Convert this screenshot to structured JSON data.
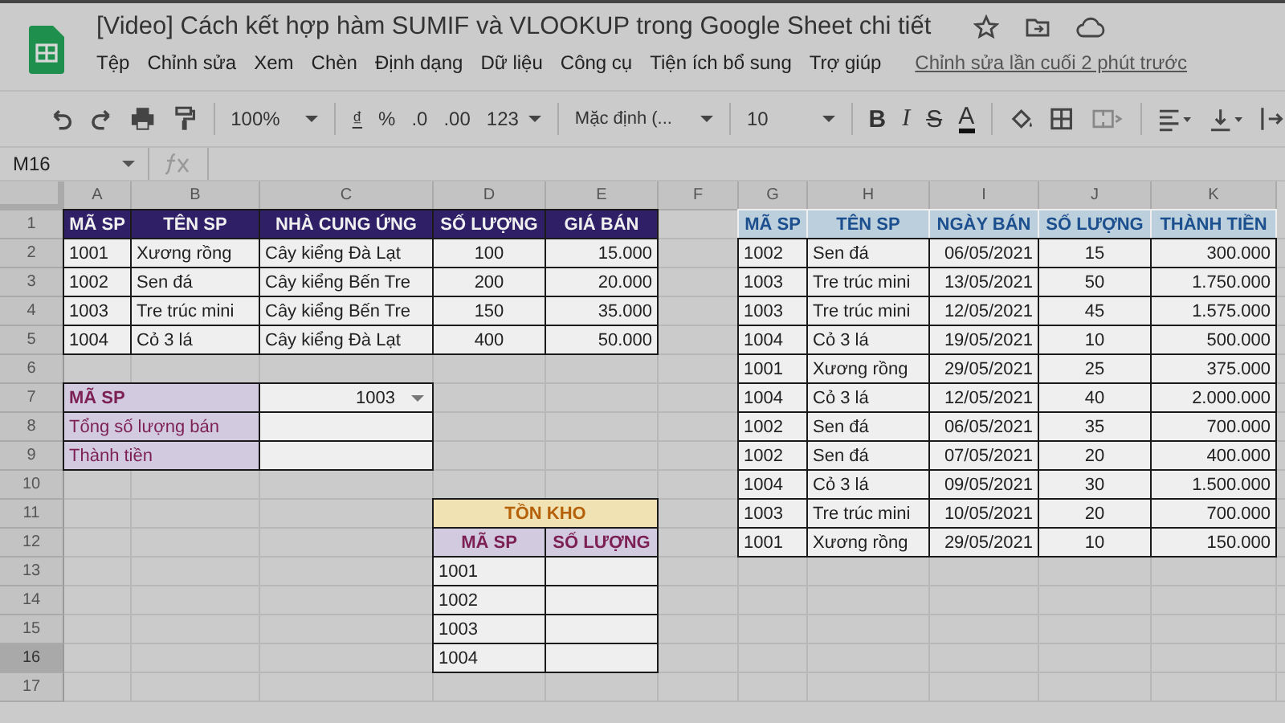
{
  "document": {
    "title": "[Video] Cách kết hợp hàm SUMIF và VLOOKUP trong Google Sheet chi tiết",
    "last_edit": "Chỉnh sửa lần cuối 2 phút trước"
  },
  "menu": [
    "Tệp",
    "Chỉnh sửa",
    "Xem",
    "Chèn",
    "Định dạng",
    "Dữ liệu",
    "Công cụ",
    "Tiện ích bổ sung",
    "Trợ giúp"
  ],
  "toolbar": {
    "zoom": "100%",
    "currency": "₫",
    "percent": "%",
    "decrease_decimals": ".0",
    "increase_decimals": ".00",
    "more_formats": "123",
    "font": "Mặc định (...",
    "font_size": "10",
    "bold": "B",
    "italic": "I",
    "strikethrough": "S",
    "text_color": "A"
  },
  "name_box": "M16",
  "columns": [
    "A",
    "B",
    "C",
    "D",
    "E",
    "F",
    "G",
    "H",
    "I",
    "J",
    "K"
  ],
  "rows": [
    {
      "label": "1",
      "selected": false
    },
    {
      "label": "2",
      "selected": false
    },
    {
      "label": "3",
      "selected": false
    },
    {
      "label": "4",
      "selected": false
    },
    {
      "label": "5",
      "selected": false
    },
    {
      "label": "6",
      "selected": false
    },
    {
      "label": "7",
      "selected": false
    },
    {
      "label": "8",
      "selected": false
    },
    {
      "label": "9",
      "selected": false
    },
    {
      "label": "10",
      "selected": false
    },
    {
      "label": "11",
      "selected": false
    },
    {
      "label": "12",
      "selected": false
    },
    {
      "label": "13",
      "selected": false
    },
    {
      "label": "14",
      "selected": false
    },
    {
      "label": "15",
      "selected": false
    },
    {
      "label": "16",
      "selected": true
    },
    {
      "label": "17",
      "selected": false
    }
  ],
  "products": {
    "headers": [
      "MÃ SP",
      "TÊN SP",
      "NHÀ CUNG ỨNG",
      "SỐ LƯỢNG",
      "GIÁ BÁN"
    ],
    "rows": [
      [
        "1001",
        "Xương rồng",
        "Cây kiểng Đà Lạt",
        "100",
        "15.000"
      ],
      [
        "1002",
        "Sen đá",
        "Cây kiểng Bến Tre",
        "200",
        "20.000"
      ],
      [
        "1003",
        "Tre trúc mini",
        "Cây kiểng Bến Tre",
        "150",
        "35.000"
      ],
      [
        "1004",
        "Cỏ 3 lá",
        "Cây kiểng Đà Lạt",
        "400",
        "50.000"
      ]
    ]
  },
  "lookup": [
    {
      "label": "MÃ SP",
      "value": "1003",
      "kind": "dropdown"
    },
    {
      "label": "Tổng số lượng bán",
      "kind": "plain"
    },
    {
      "label": "Thành tiền",
      "kind": "plain"
    }
  ],
  "sales": {
    "headers": [
      "MÃ SP",
      "TÊN SP",
      "NGÀY BÁN",
      "SỐ LƯỢNG",
      "THÀNH TIỀN"
    ],
    "rows": [
      [
        "1002",
        "Sen đá",
        "06/05/2021",
        "15",
        "300.000"
      ],
      [
        "1003",
        "Tre trúc mini",
        "13/05/2021",
        "50",
        "1.750.000"
      ],
      [
        "1003",
        "Tre trúc mini",
        "12/05/2021",
        "45",
        "1.575.000"
      ],
      [
        "1004",
        "Cỏ 3 lá",
        "19/05/2021",
        "10",
        "500.000"
      ],
      [
        "1001",
        "Xương rồng",
        "29/05/2021",
        "25",
        "375.000"
      ],
      [
        "1004",
        "Cỏ 3 lá",
        "12/05/2021",
        "40",
        "2.000.000"
      ],
      [
        "1002",
        "Sen đá",
        "06/05/2021",
        "35",
        "700.000"
      ],
      [
        "1002",
        "Sen đá",
        "07/05/2021",
        "20",
        "400.000"
      ],
      [
        "1004",
        "Cỏ 3 lá",
        "09/05/2021",
        "30",
        "1.500.000"
      ],
      [
        "1003",
        "Tre trúc mini",
        "10/05/2021",
        "20",
        "700.000"
      ],
      [
        "1001",
        "Xương rồng",
        "29/05/2021",
        "10",
        "150.000"
      ]
    ]
  },
  "stock": {
    "title": "TỒN KHO",
    "headers": [
      "MÃ SP",
      "SỐ LƯỢNG"
    ],
    "rows": [
      [
        "1001"
      ],
      [
        "1002"
      ],
      [
        "1003"
      ],
      [
        "1004"
      ]
    ]
  }
}
